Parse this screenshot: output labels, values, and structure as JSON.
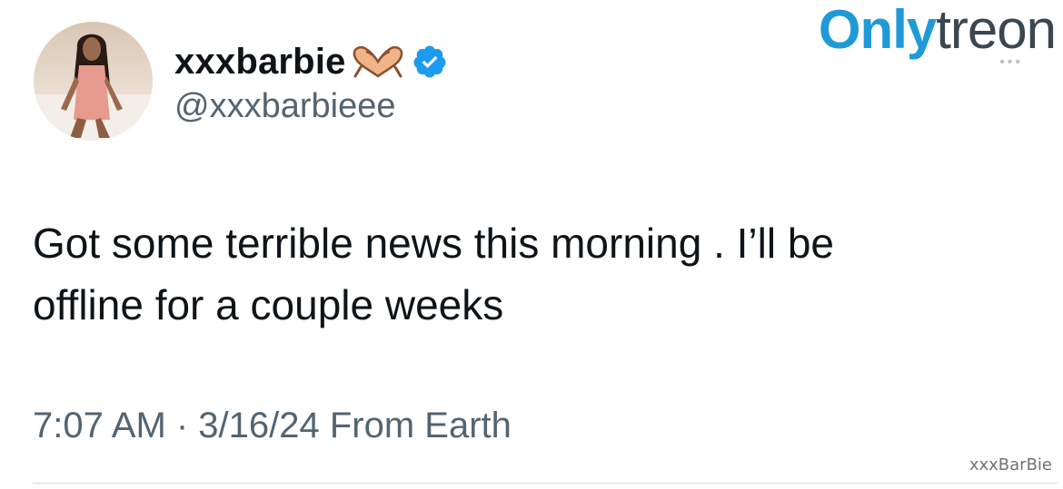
{
  "author": {
    "display_name": "xxxbarbie",
    "handle": "@xxxbarbieee",
    "emoji_icon": "heart-hands-icon",
    "verified_icon": "verified-badge-icon"
  },
  "tweet": {
    "text_line_1": "Got some terrible news this morning . I’ll be",
    "text_line_2": "offline for a couple weeks",
    "meta": "7:07 AM · 3/16/24 From Earth"
  },
  "watermark": {
    "brand_part_1": "Only",
    "brand_part_2": "treon",
    "brand_dots": "•••",
    "user": "xxxBarBie"
  },
  "colors": {
    "verified": "#1d9bf0",
    "secondary_text": "#536471",
    "brand_blue": "#1f9ad6"
  }
}
